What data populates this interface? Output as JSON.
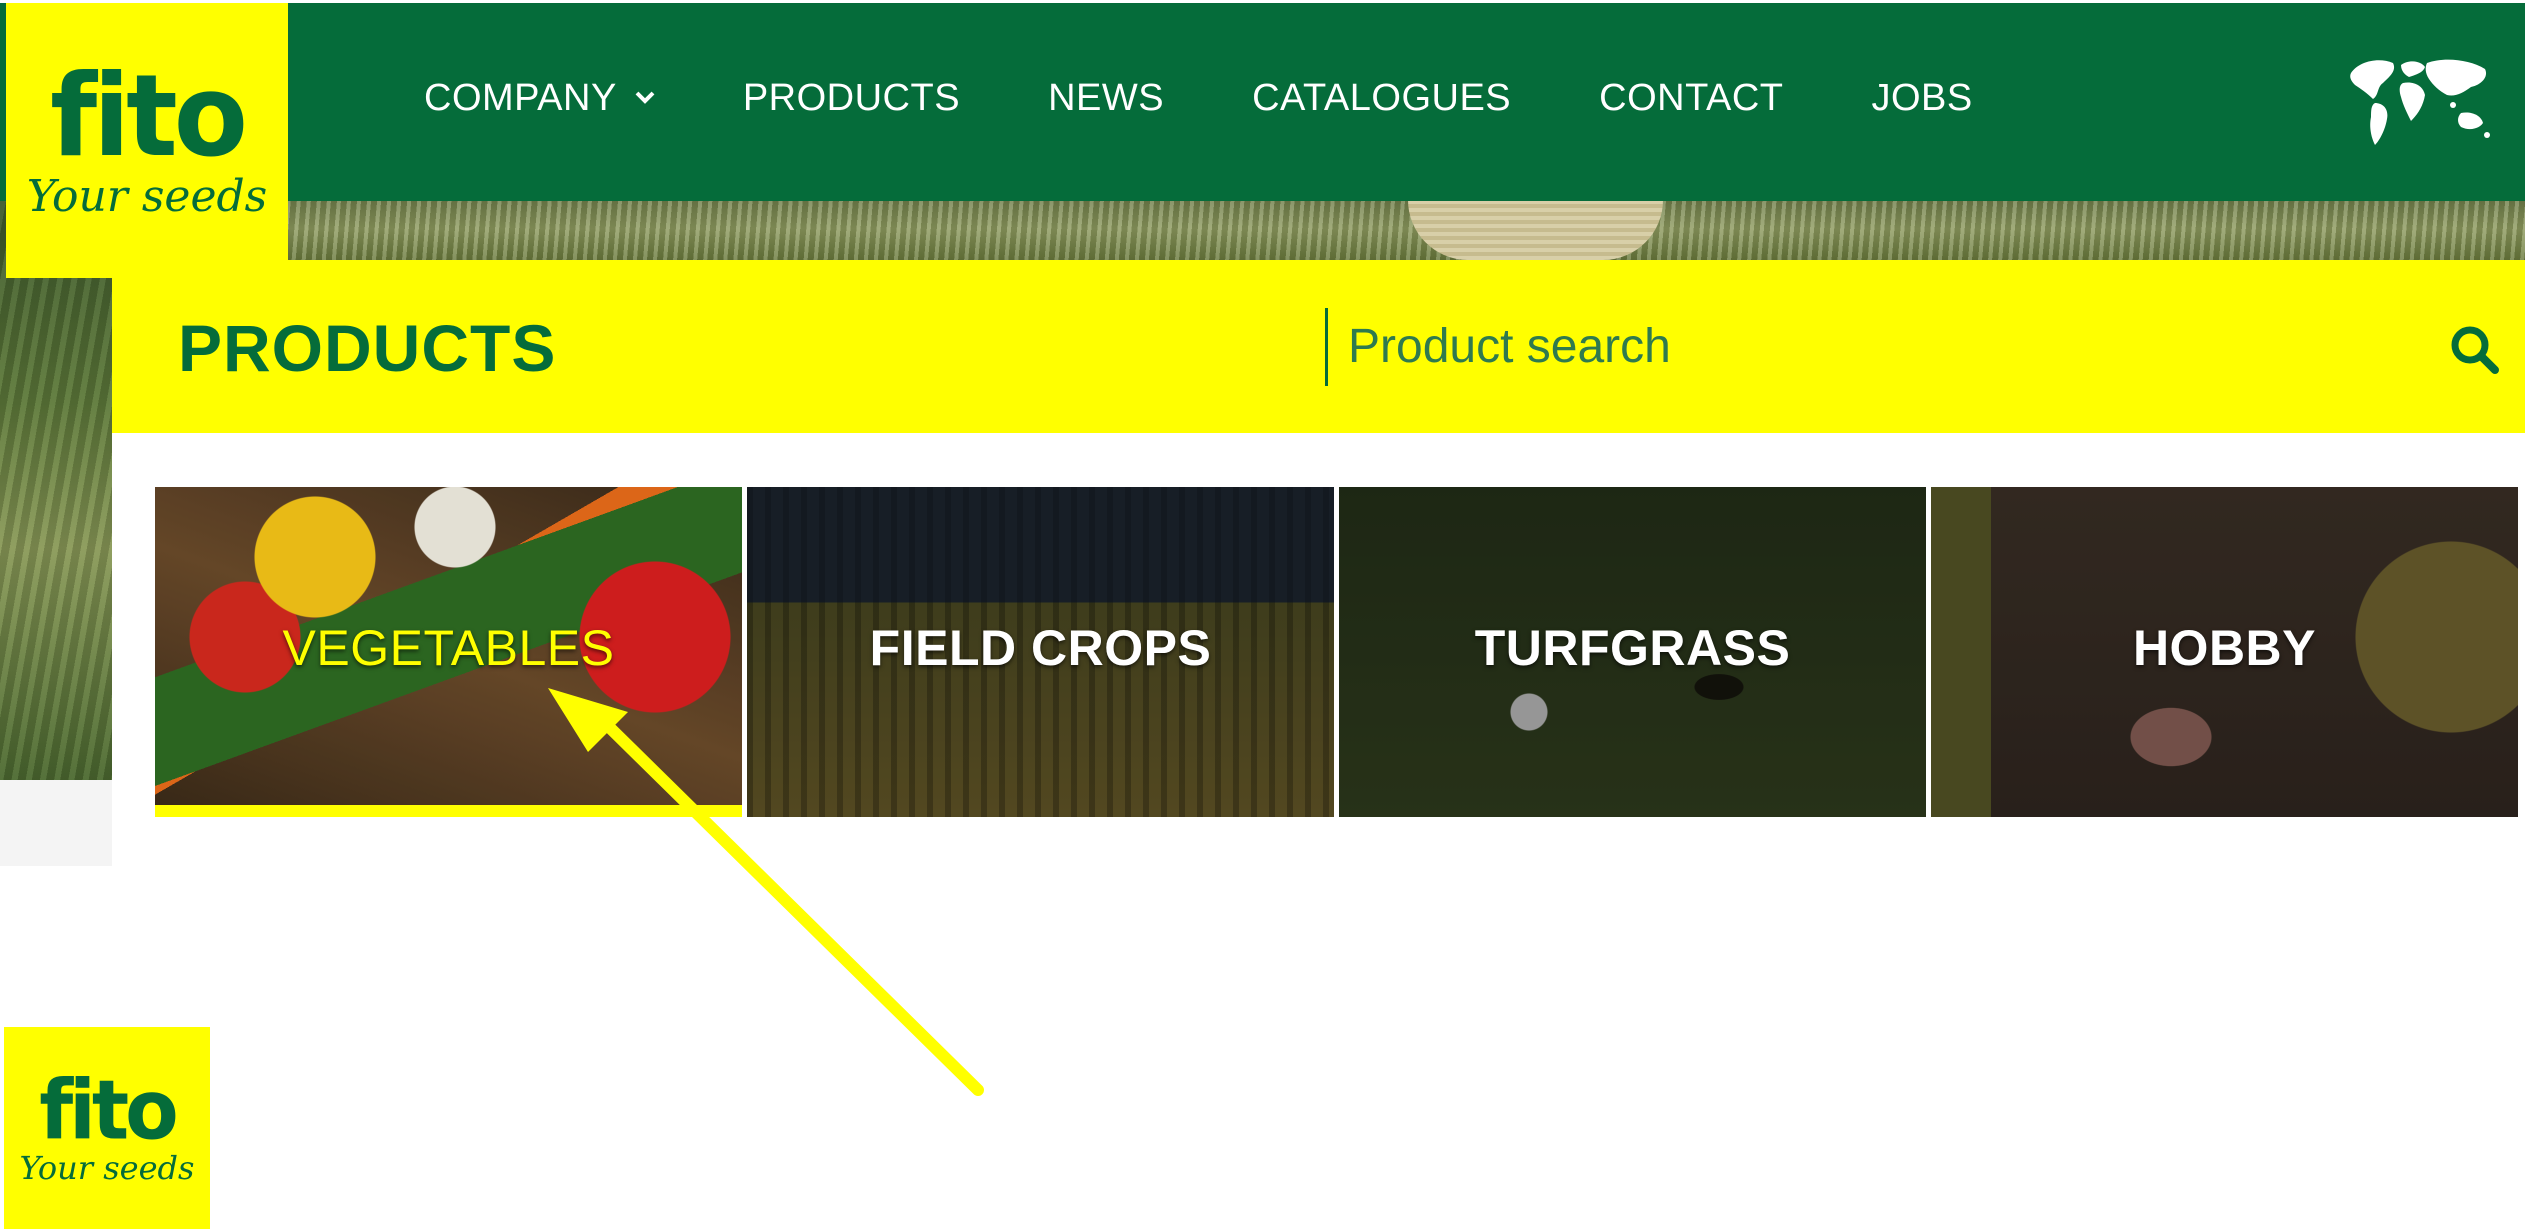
{
  "logo": {
    "word": "fito",
    "tagline": "Your seeds"
  },
  "nav": {
    "items": [
      {
        "label": "COMPANY",
        "has_dropdown": true
      },
      {
        "label": "PRODUCTS"
      },
      {
        "label": "NEWS"
      },
      {
        "label": "CATALOGUES"
      },
      {
        "label": "CONTACT"
      },
      {
        "label": "JOBS"
      }
    ],
    "language_icon": "world-map-icon"
  },
  "products": {
    "title": "PRODUCTS",
    "search_placeholder": "Product search",
    "search_icon": "search-icon"
  },
  "tiles": [
    {
      "label": "VEGETABLES",
      "active": true
    },
    {
      "label": "FIELD CROPS"
    },
    {
      "label": "TURFGRASS"
    },
    {
      "label": "HOBBY"
    }
  ],
  "colors": {
    "brand_green": "#056c3a",
    "brand_yellow": "#ffff00"
  }
}
